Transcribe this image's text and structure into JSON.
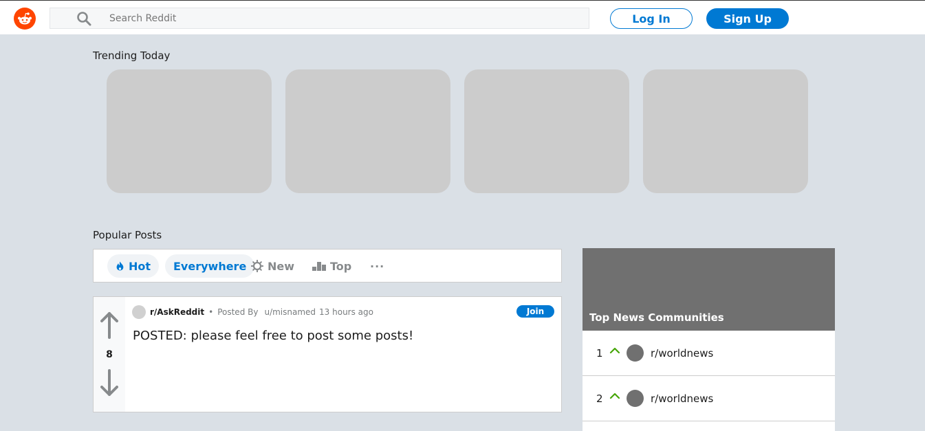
{
  "header": {
    "search_placeholder": "Search Reddit",
    "login_label": "Log In",
    "signup_label": "Sign Up",
    "brand_color": "#ff4500",
    "accent_color": "#0079d3"
  },
  "trending": {
    "title": "Trending Today",
    "card_count": 4
  },
  "popular": {
    "title": "Popular Posts",
    "sort": {
      "hot": "Hot",
      "everywhere": "Everywhere",
      "new": "New",
      "top": "Top",
      "more": "···"
    }
  },
  "post": {
    "subreddit": "r/AskReddit",
    "separator": "•",
    "posted_by_label": "Posted By",
    "author": "u/misnamed",
    "time": "13 hours ago",
    "title": "POSTED: please feel free to post some posts!",
    "votes": "8",
    "join_label": "Join"
  },
  "sidebar": {
    "title": "Top News Communities",
    "communities": [
      {
        "rank": "1",
        "name": "r/worldnews"
      },
      {
        "rank": "2",
        "name": "r/worldnews"
      }
    ]
  }
}
